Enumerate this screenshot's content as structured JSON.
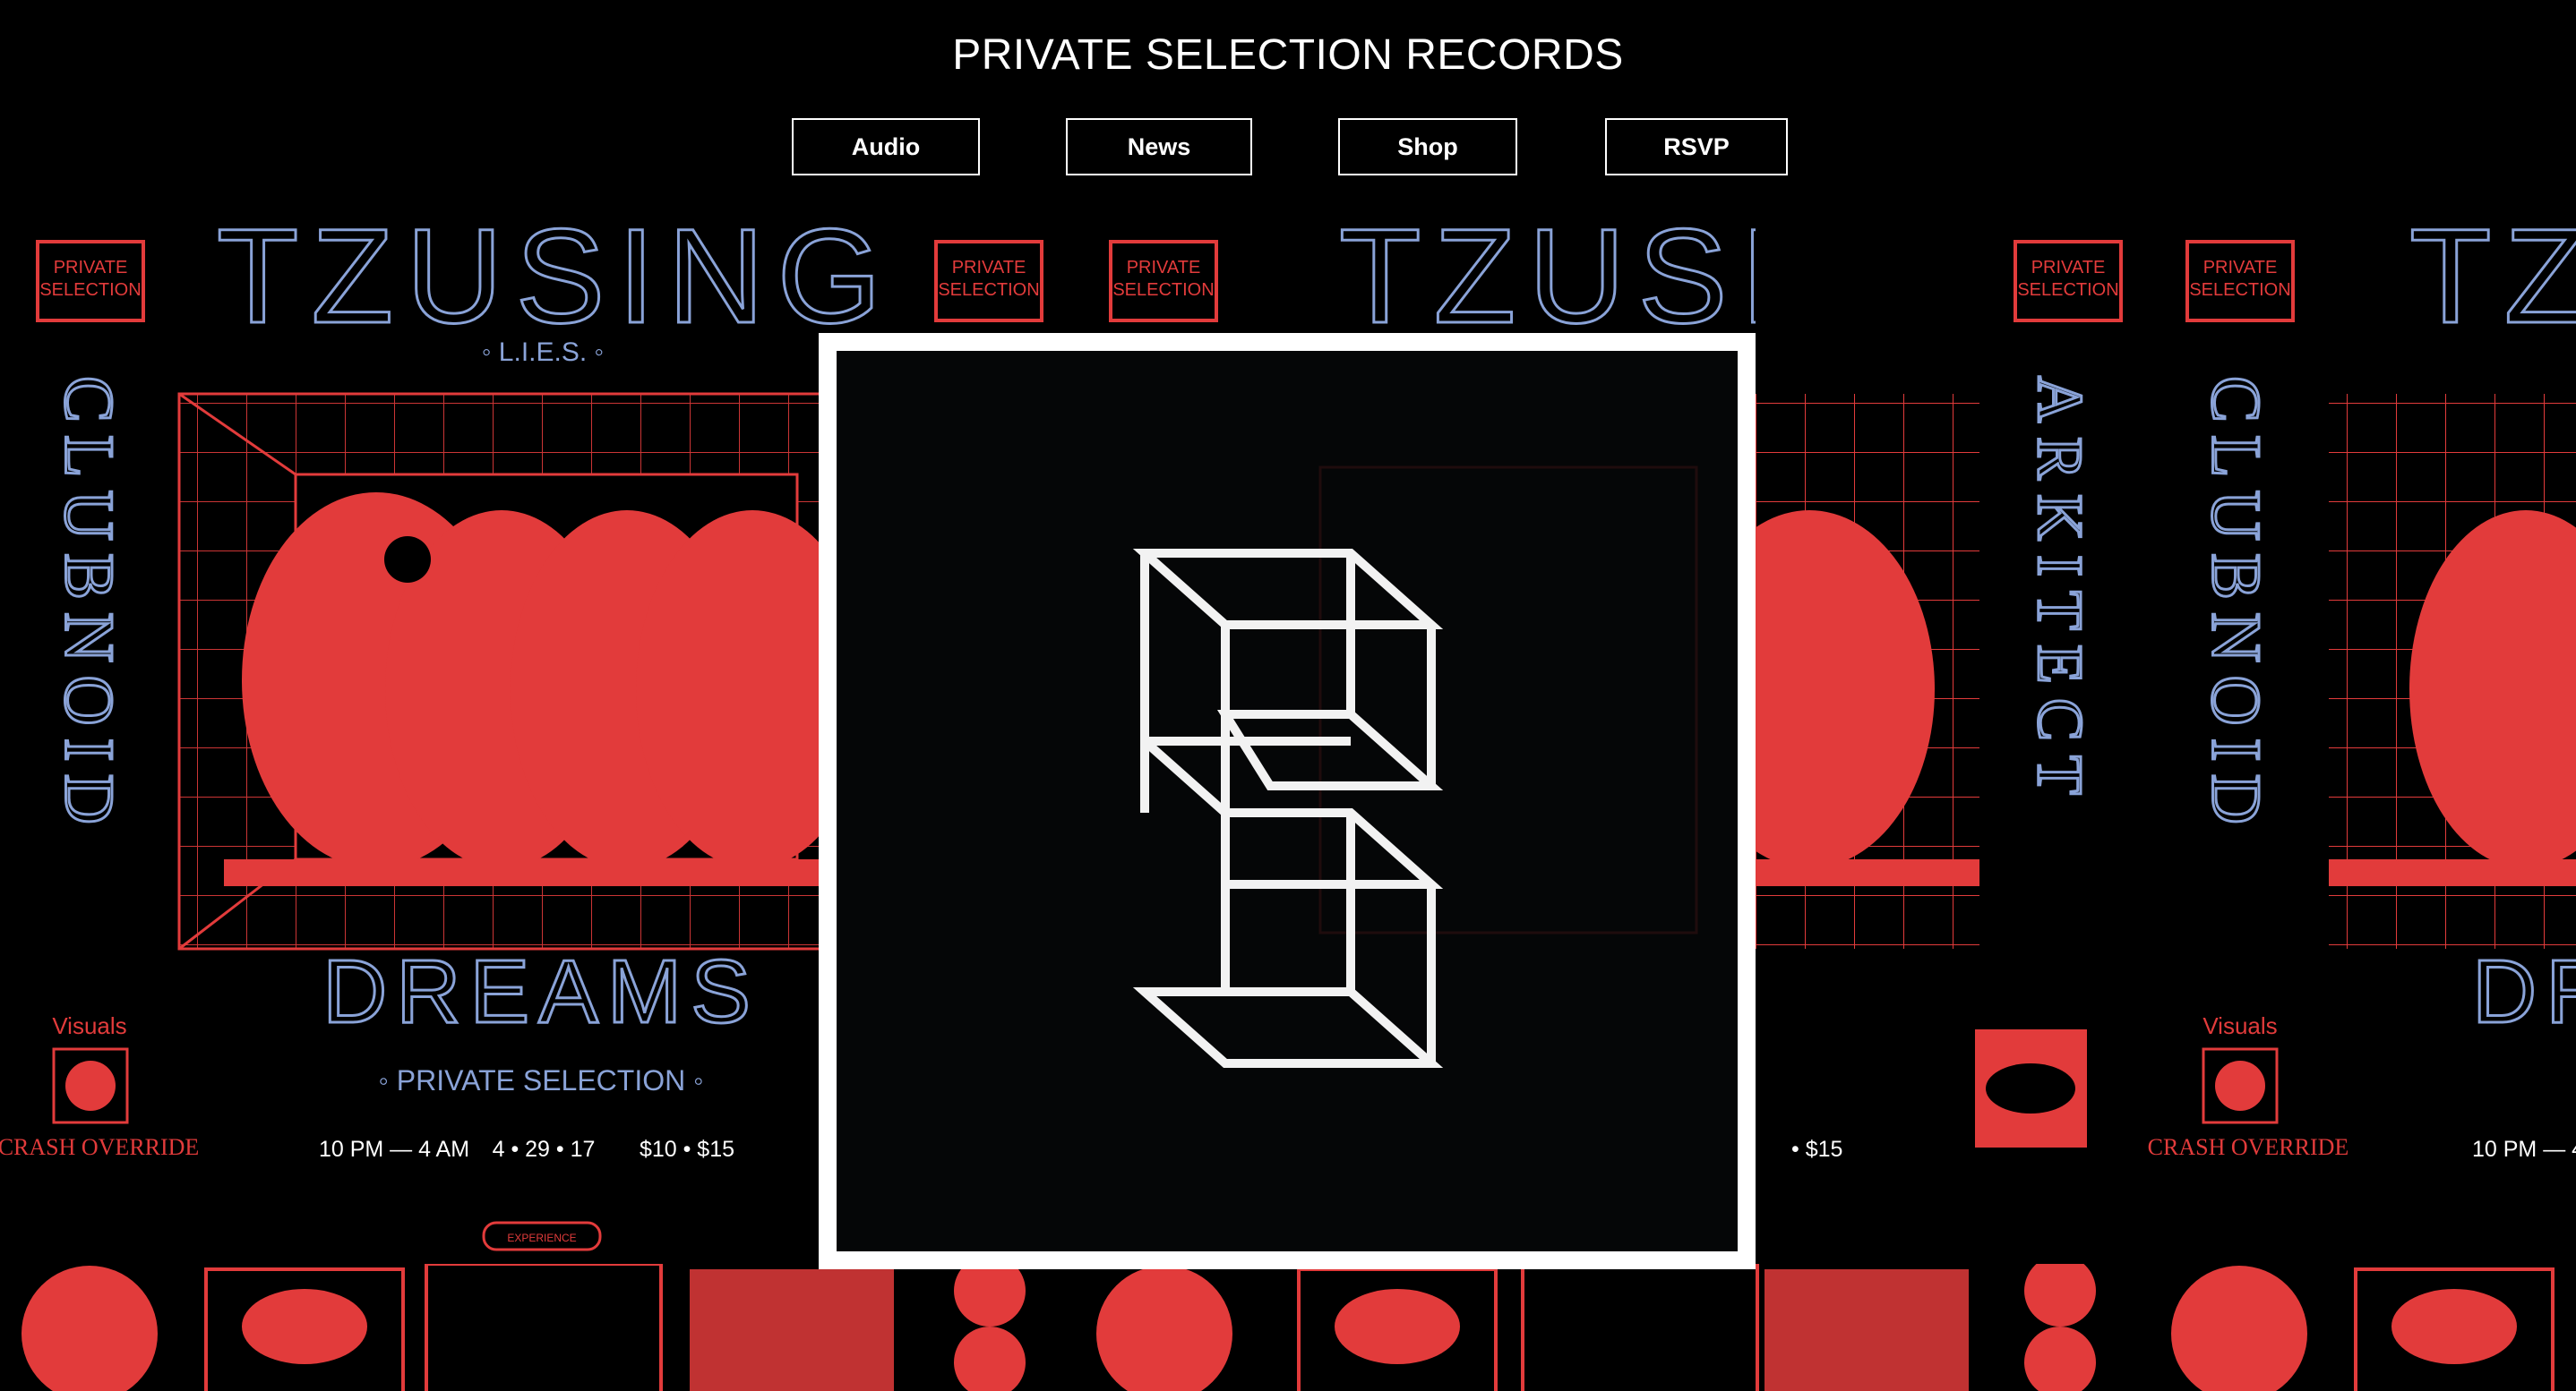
{
  "site": {
    "title": "PRIVATE SELECTION RECORDS"
  },
  "nav": {
    "items": [
      {
        "label": "Audio"
      },
      {
        "label": "News"
      },
      {
        "label": "Shop"
      },
      {
        "label": "RSVP"
      }
    ]
  },
  "poster_a": {
    "badge_line1": "PRIVATE",
    "badge_line2": "SELECTION",
    "headliner": "TZUSING",
    "headliner_sub": "◦ L.I.E.S. ◦",
    "vertical_name": "CLUBNOID",
    "visuals_label": "Visuals",
    "visuals_name": "CRASH OVERRIDE",
    "event_title": "DREAMS",
    "presenter": "◦ PRIVATE SELECTION ◦",
    "time": "10 PM — 4 AM",
    "date": "4 • 29 • 17",
    "price": "$10 • $15",
    "experience": "EXPERIENCE"
  },
  "poster_b": {
    "badge_line1": "PRIVATE",
    "badge_line2": "SELECTION",
    "vertical_name": "ARKITECT",
    "price_suffix": "• $15"
  },
  "colors": {
    "background": "#000000",
    "poster_red": "#e23b3b",
    "poster_blue": "#8aa3d8",
    "modal_frame": "#ffffff",
    "modal_bg": "#050607"
  },
  "icons": {
    "logo": "private-selection-s-cube-logo"
  }
}
